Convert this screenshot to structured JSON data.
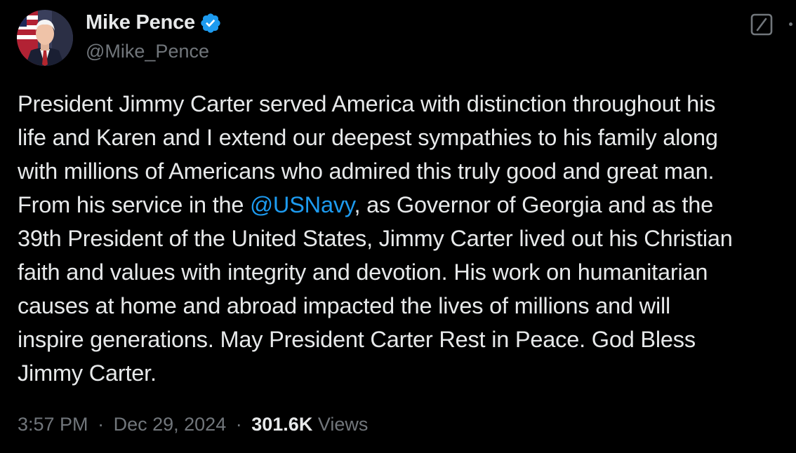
{
  "author": {
    "display_name": "Mike Pence",
    "handle": "@Mike_Pence",
    "verified": true
  },
  "tweet": {
    "lines": [
      [
        "President Jimmy Carter served America with distinction throughout his"
      ],
      [
        "life and Karen and I extend our deepest sympathies to his family along"
      ],
      [
        "with millions of Americans who admired this truly good and great man."
      ],
      [
        "From his service in the ",
        "@USNavy",
        ", as Governor of Georgia and as the"
      ],
      [
        "39th President of the United States, Jimmy Carter lived out his Christian"
      ],
      [
        "faith and values with integrity and devotion. His work on humanitarian"
      ],
      [
        "causes at home and abroad impacted the lives of millions and will"
      ],
      [
        "inspire generations. May President Carter Rest in Peace. God Bless"
      ],
      [
        "Jimmy Carter."
      ]
    ],
    "mention": "@USNavy"
  },
  "meta": {
    "time": "3:57 PM",
    "separator": "·",
    "date": "Dec 29, 2024",
    "views_count": "301.6K",
    "views_label": "Views"
  },
  "icons": {
    "verified": "verified-badge-icon",
    "grok": "grok-icon",
    "more": "more-icon"
  },
  "colors": {
    "background": "#000000",
    "text_primary": "#e7e9ea",
    "text_secondary": "#71767b",
    "link": "#1d9bf0",
    "verified": "#1d9bf0"
  }
}
